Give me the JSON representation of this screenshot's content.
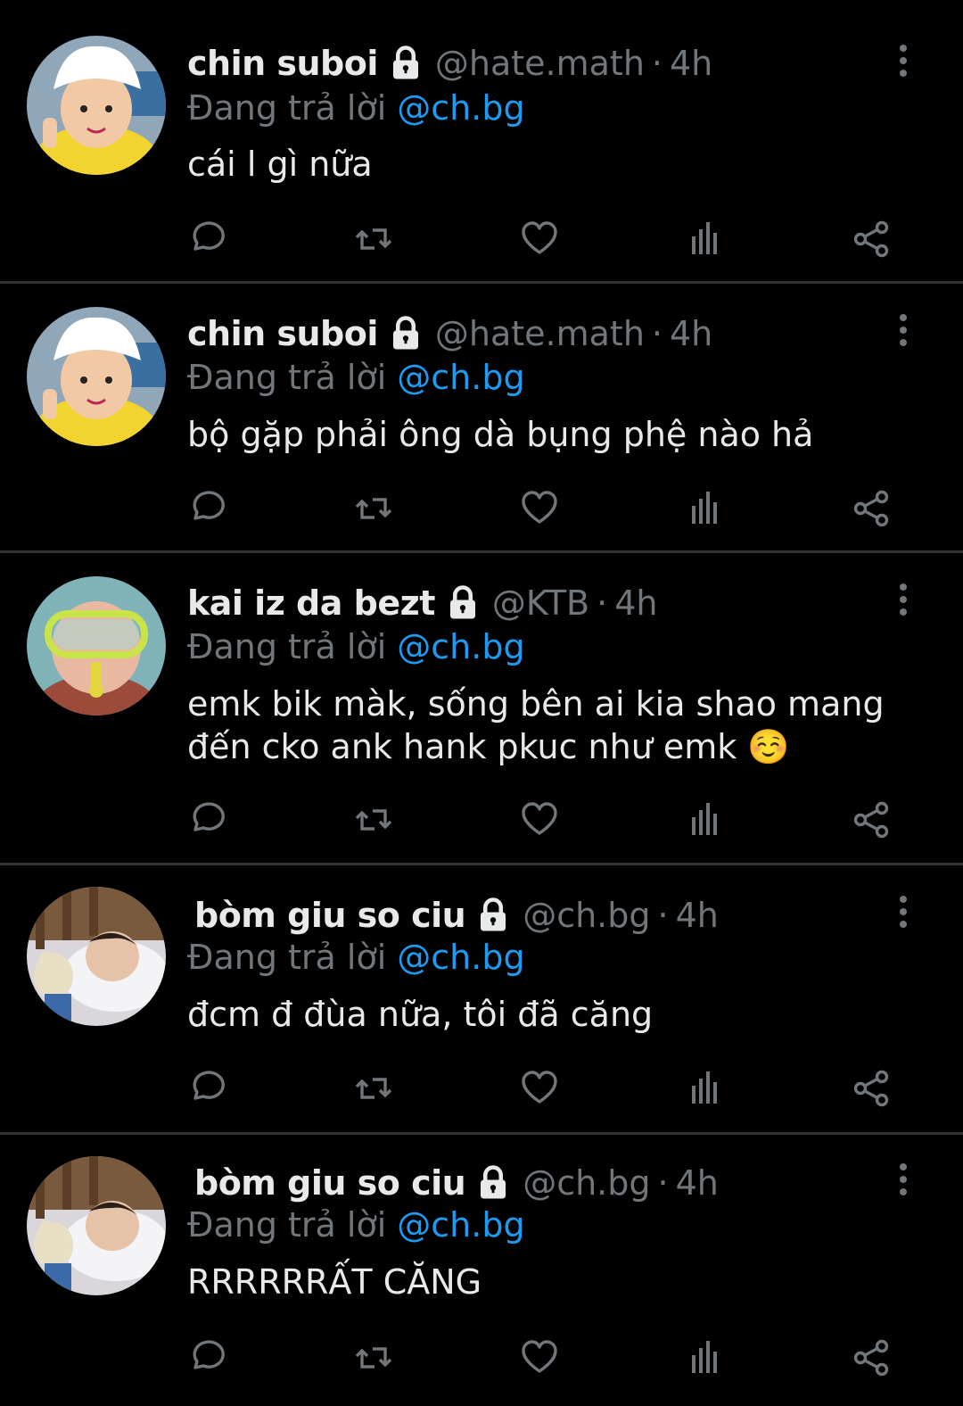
{
  "colors": {
    "background": "#000000",
    "text": "#e7e9ea",
    "muted": "#71767b",
    "mention": "#1d9bf0",
    "divider": "#2f3336"
  },
  "reply_label": "Đang trả lời",
  "tweets": [
    {
      "name": "chin suboi",
      "handle": "@hate.math",
      "time": "4h",
      "reply_to": "@ch.bg",
      "text": "cái l gì nữa",
      "avatar": "child-chef-hat"
    },
    {
      "name": "chin suboi",
      "handle": "@hate.math",
      "time": "4h",
      "reply_to": "@ch.bg",
      "text": "bộ gặp phải ông dà bụng phệ nào hả",
      "avatar": "child-chef-hat"
    },
    {
      "name": "kai iz da bezt",
      "handle": "@KTB",
      "time": "4h",
      "reply_to": "@ch.bg",
      "text": "emk bik màk, sống bên ai kia shao mang đến cko ank hank pkuc như emk ☺️",
      "avatar": "child-diving-mask"
    },
    {
      "name": "bòm giu so ciu",
      "handle": "@ch.bg",
      "time": "4h",
      "reply_to": "@ch.bg",
      "text": "đcm đ đùa nữa, tôi đã căng",
      "avatar": "baby-sleeping"
    },
    {
      "name": "bòm giu so ciu",
      "handle": "@ch.bg",
      "time": "4h",
      "reply_to": "@ch.bg",
      "text": "RRRRRRẤT CĂNG",
      "avatar": "baby-sleeping"
    }
  ],
  "action_icons": [
    "reply-icon",
    "retweet-icon",
    "like-icon",
    "views-icon",
    "share-icon"
  ]
}
